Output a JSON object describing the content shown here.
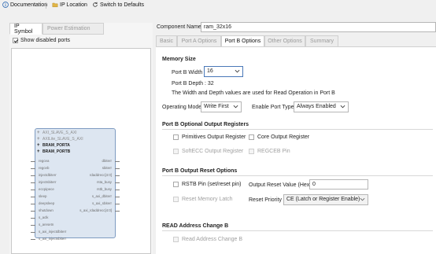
{
  "toolbar": {
    "documentation": "Documentation",
    "ip_location": "IP Location",
    "switch_defaults": "Switch to Defaults"
  },
  "left_tabs": [
    "IP Symbol",
    "Power Estimation"
  ],
  "show_disabled_ports": "Show disabled ports",
  "symbol": {
    "bus_ports": [
      {
        "label": "AXI_SLAVE_S_AXI",
        "enabled": false
      },
      {
        "label": "AXILite_SLAVE_S_AXI",
        "enabled": false
      },
      {
        "label": "BRAM_PORTA",
        "enabled": true
      },
      {
        "label": "BRAM_PORTB",
        "enabled": true
      }
    ],
    "left_ports": [
      "regcea",
      "regceb",
      "injectdbiterr",
      "injectsbiterr",
      "eccpipece",
      "sleep",
      "deepsleep",
      "shutdown",
      "s_aclk",
      "s_aresetn",
      "s_axi_injectdbiterr",
      "s_axi_injectsbiterr"
    ],
    "right_ports": [
      "dbiterr",
      "sbiterr",
      "rdaddrecc[4:0]",
      "rsta_busy",
      "rstb_busy",
      "s_axi_dbiterr",
      "s_axi_sbiterr",
      "s_axi_rdaddrecc[4:0]"
    ]
  },
  "component_name_label": "Component Name",
  "component_name": "ram_32x16",
  "tabs": [
    "Basic",
    "Port A Options",
    "Port B Options",
    "Other Options",
    "Summary"
  ],
  "memory_size": {
    "title": "Memory Size",
    "port_b_width_label": "Port B Width",
    "port_b_width": "16",
    "port_b_depth": "Port B Depth : 32",
    "note": "The Width and Depth values are used for Read Operation in Port B"
  },
  "operating_mode": {
    "label": "Operating Mode",
    "value": "Write First"
  },
  "enable_port_type": {
    "label": "Enable Port Type",
    "value": "Always Enabled"
  },
  "optional_output_registers": {
    "title": "Port B Optional Output Registers",
    "primitives": "Primitives Output Register",
    "core": "Core Output Register",
    "softecc": "SoftECC Output Register",
    "regceb": "REGCEB Pin"
  },
  "output_reset": {
    "title": "Port B Output Reset Options",
    "rstb_pin": "RSTB Pin (set/reset pin)",
    "reset_value_label": "Output Reset Value (Hex)",
    "reset_value": "0",
    "reset_memory_latch": "Reset Memory Latch",
    "reset_priority_label": "Reset Priority",
    "reset_priority": "CE (Latch or Register Enable)"
  },
  "read_address_change": {
    "title": "READ Address Change B",
    "option": "Read Address Change B"
  }
}
